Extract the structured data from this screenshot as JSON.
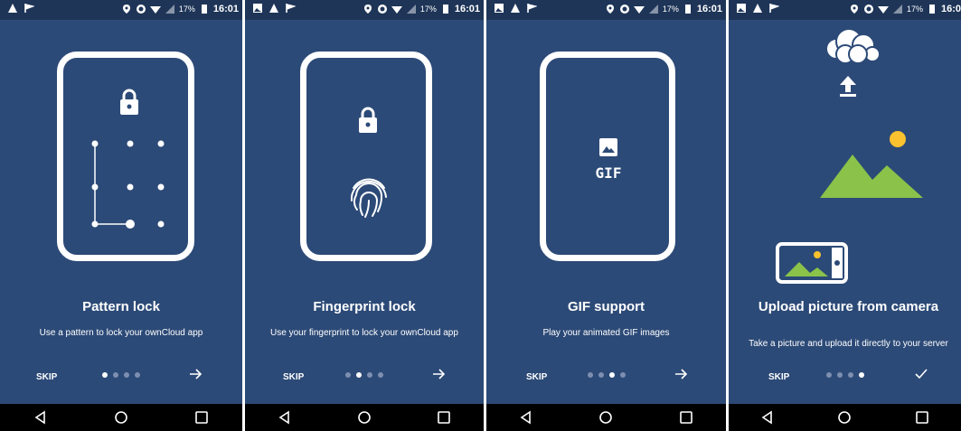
{
  "status_bar": {
    "battery": "17%",
    "time": "16:01",
    "time_cut": "16:0"
  },
  "screens": [
    {
      "title": "Pattern lock",
      "subtitle": "Use a pattern to lock your ownCloud app",
      "skip": "SKIP",
      "next_icon": "arrow-right-icon",
      "active_dot": 0
    },
    {
      "title": "Fingerprint lock",
      "subtitle": "Use your fingerprint to lock your ownCloud app",
      "skip": "SKIP",
      "next_icon": "arrow-right-icon",
      "active_dot": 1
    },
    {
      "title": "GIF support",
      "subtitle": "Play your animated GIF images",
      "skip": "SKIP",
      "next_icon": "arrow-right-icon",
      "active_dot": 2,
      "gif_label": "GIF"
    },
    {
      "title": "Upload picture from camera",
      "subtitle": "Take a picture and upload it directly to your server",
      "skip": "SKIP",
      "next_icon": "checkmark-icon",
      "active_dot": 3
    }
  ],
  "colors": {
    "background": "#2c4a77",
    "status_bar": "#1e3558",
    "accent_green": "#8bc34a",
    "sun_yellow": "#f9c22e"
  }
}
